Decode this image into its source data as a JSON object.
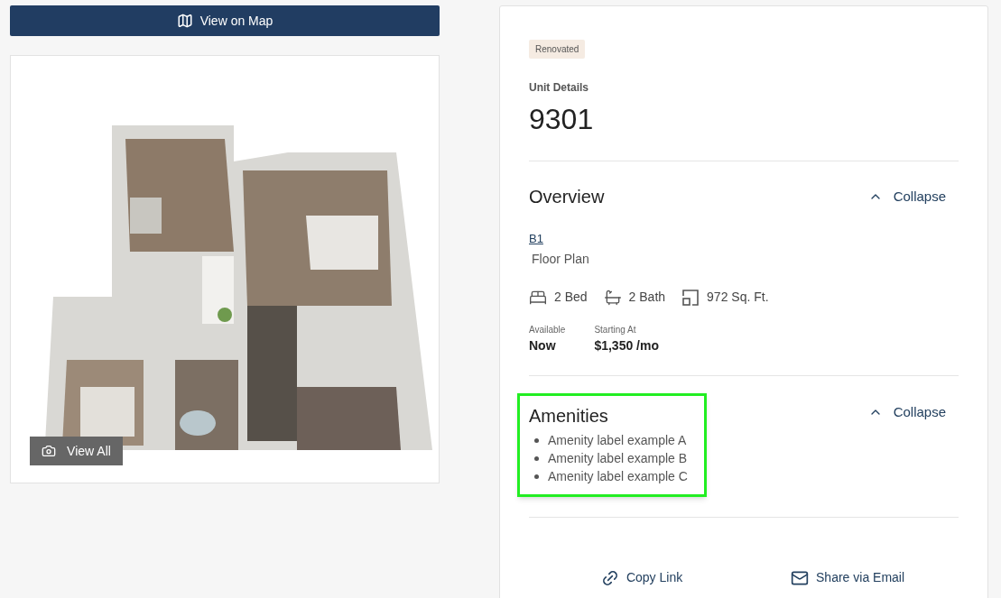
{
  "map_button": {
    "label": "View on Map"
  },
  "gallery": {
    "kind": "picture",
    "view_all": "View All"
  },
  "unit": {
    "badge": "Renovated",
    "label": "Unit Details",
    "number": "9301"
  },
  "overview": {
    "title": "Overview",
    "toggle": "Collapse",
    "expanded": true,
    "floor_plan_link": "B1",
    "floor_plan_label": "Floor Plan",
    "features": [
      {
        "kind": "bed",
        "text": "2 Bed"
      },
      {
        "kind": "bath",
        "text": "2 Bath"
      },
      {
        "kind": "area",
        "text": "972 Sq. Ft."
      }
    ],
    "facts": [
      {
        "label": "Available",
        "value": "Now"
      },
      {
        "label": "Starting At",
        "value": "$1,350 /mo"
      }
    ]
  },
  "amenities": {
    "title": "Amenities",
    "toggle": "Collapse",
    "expanded": true,
    "highlighted": true,
    "items": [
      "Amenity label example A",
      "Amenity label example B",
      "Amenity label example C"
    ]
  },
  "actions": [
    {
      "kind": "link",
      "label": "Copy Link"
    },
    {
      "kind": "email",
      "label": "Share via Email"
    }
  ]
}
